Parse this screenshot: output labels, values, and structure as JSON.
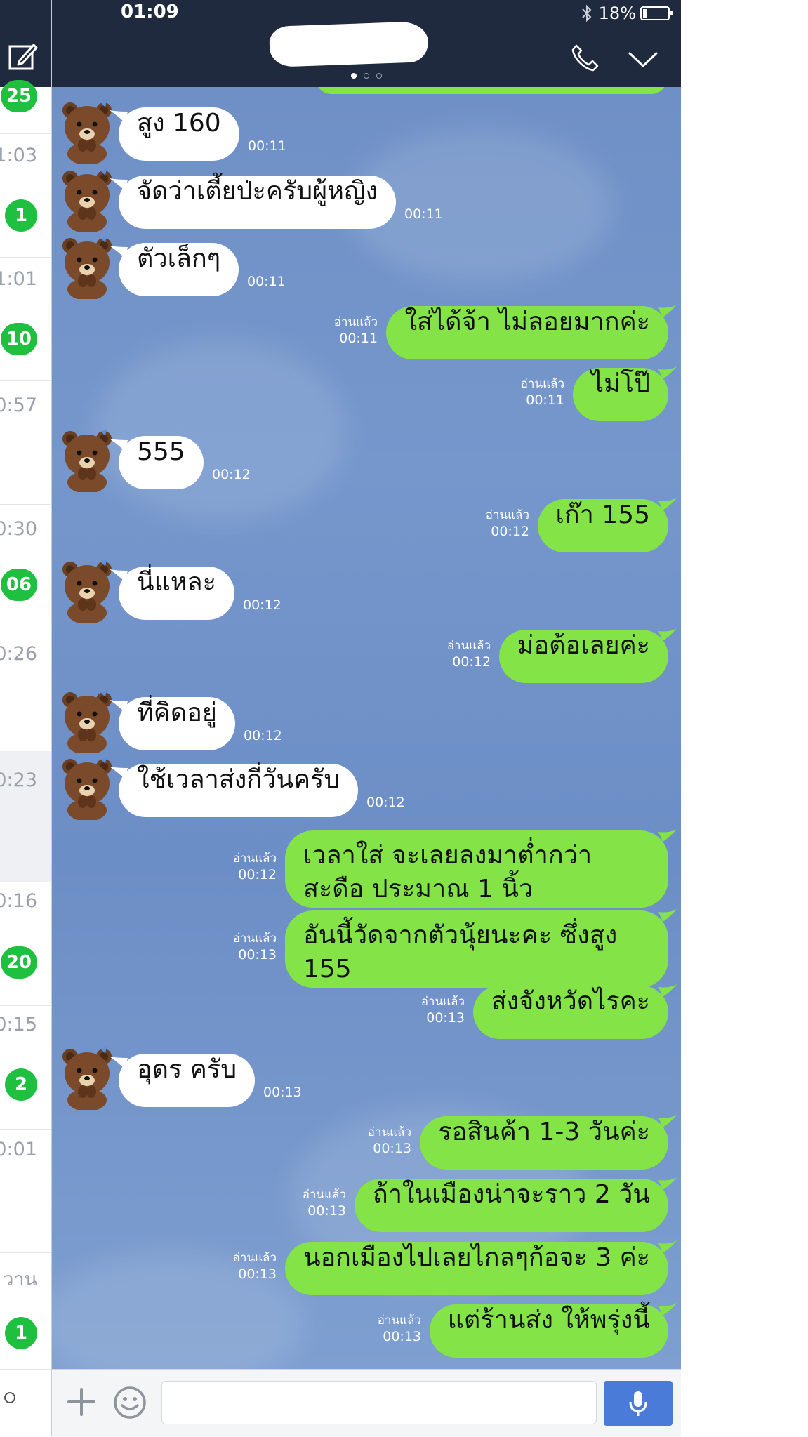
{
  "status_bar": {
    "time": "01:09",
    "battery": "18%"
  },
  "chat_list": {
    "rows": [
      {
        "time": "",
        "badge": "25"
      },
      {
        "time": "1:03",
        "badge": "1"
      },
      {
        "time": "1:01",
        "badge": "10"
      },
      {
        "time": "0:57",
        "badge": ""
      },
      {
        "time": "0:30",
        "badge": "06"
      },
      {
        "time": "0:26",
        "badge": ""
      },
      {
        "time": "0:23",
        "badge": ""
      },
      {
        "time": "0:16",
        "badge": "20"
      },
      {
        "time": "0:15",
        "badge": "2"
      },
      {
        "time": "0:01",
        "badge": ""
      },
      {
        "time": "วาน",
        "badge": "1"
      }
    ]
  },
  "messages": [
    {
      "side": "in",
      "text": "สูง 160",
      "time": "00:11"
    },
    {
      "side": "in",
      "text": "จัดว่าเตี้ยป่ะครับผู้หญิง",
      "time": "00:11"
    },
    {
      "side": "in",
      "text": "ตัวเล็กๆ",
      "time": "00:11"
    },
    {
      "side": "out",
      "text": "ใส่ได้จ้า ไม่ลอยมากค่ะ",
      "time": "00:11",
      "read": "อ่านแล้ว"
    },
    {
      "side": "out",
      "text": "ไม่โป๊",
      "time": "00:11",
      "read": "อ่านแล้ว"
    },
    {
      "side": "in",
      "text": "555",
      "time": "00:12"
    },
    {
      "side": "out",
      "text": "เก๊า 155",
      "time": "00:12",
      "read": "อ่านแล้ว"
    },
    {
      "side": "in",
      "text": "นี่แหละ",
      "time": "00:12"
    },
    {
      "side": "out",
      "text": "ม่อต้อเลยค่ะ",
      "time": "00:12",
      "read": "อ่านแล้ว"
    },
    {
      "side": "in",
      "text": "ที่คิดอยู่",
      "time": "00:12"
    },
    {
      "side": "in",
      "text": "ใช้เวลาส่งกี่วันครับ",
      "time": "00:12"
    },
    {
      "side": "out",
      "text": "เวลาใส่ จะเลยลงมาต่ำกว่าสะดือ ประมาณ 1 นิ้ว",
      "time": "00:12",
      "read": "อ่านแล้ว"
    },
    {
      "side": "out",
      "text": "อันนี้วัดจากตัวนุ้ยนะคะ ซึ่งสูง 155",
      "time": "00:13",
      "read": "อ่านแล้ว"
    },
    {
      "side": "out",
      "text": "ส่งจังหวัดไรคะ",
      "time": "00:13",
      "read": "อ่านแล้ว"
    },
    {
      "side": "in",
      "text": "อุดร ครับ",
      "time": "00:13"
    },
    {
      "side": "out",
      "text": "รอสินค้า 1-3 วันค่ะ",
      "time": "00:13",
      "read": "อ่านแล้ว"
    },
    {
      "side": "out",
      "text": "ถ้าในเมืองน่าจะราว 2 วัน",
      "time": "00:13",
      "read": "อ่านแล้ว"
    },
    {
      "side": "out",
      "text": "นอกเมืองไปเลยไกลๆก้อจะ 3 ค่ะ",
      "time": "00:13",
      "read": "อ่านแล้ว"
    },
    {
      "side": "out",
      "text": "แต่ร้านส่ง ให้พรุ่งนี้",
      "time": "00:13",
      "read": "อ่านแล้ว"
    }
  ],
  "input": {
    "placeholder": ""
  },
  "colors": {
    "header": "#1f2a3f",
    "chat_background": "#7597cc",
    "incoming_bubble": "#ffffff",
    "outgoing_bubble": "#84e347",
    "badge": "#1fbf3f",
    "mic_button": "#4a7bd9"
  },
  "icons": [
    "compose-icon",
    "bluetooth-icon",
    "battery-icon",
    "call-icon",
    "chevron-down-icon",
    "plus-icon",
    "emoji-icon",
    "mic-icon",
    "bear-avatar-icon"
  ]
}
